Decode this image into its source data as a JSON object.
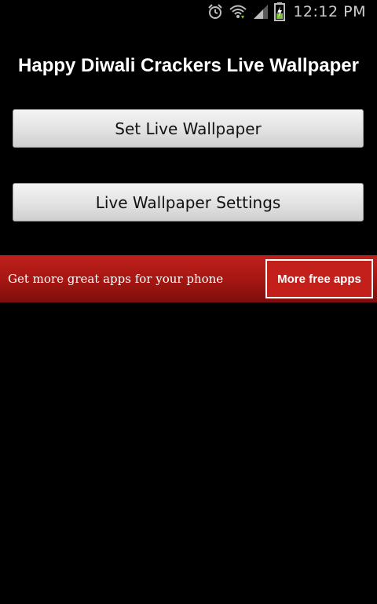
{
  "status_bar": {
    "time": "12:12 PM",
    "icons": [
      "alarm-clock-icon",
      "wifi-icon",
      "signal-icon",
      "battery-charging-icon"
    ]
  },
  "app": {
    "title": "Happy Diwali Crackers Live Wallpaper"
  },
  "buttons": {
    "set_wallpaper": "Set Live Wallpaper",
    "settings": "Live Wallpaper Settings"
  },
  "ad": {
    "text": "Get more great apps for your phone",
    "button": "More free apps"
  },
  "colors": {
    "background": "#000000",
    "ad_red": "#a41612",
    "button_gray": "#e4e4e4"
  }
}
